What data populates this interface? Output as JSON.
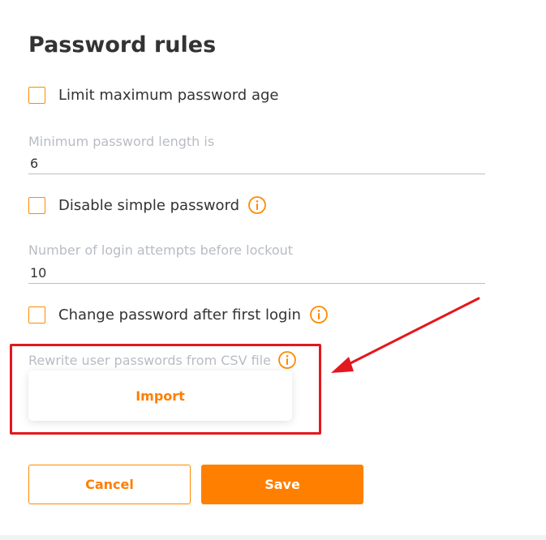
{
  "page": {
    "title": "Password rules"
  },
  "rules": {
    "limit_age_label": "Limit maximum password age",
    "min_length_label": "Minimum password length is",
    "min_length_value": "6",
    "disable_simple_label": "Disable simple password",
    "login_attempts_label": "Number of login attempts before lockout",
    "login_attempts_value": "10",
    "change_after_first_label": "Change password after first login",
    "rewrite_csv_label": "Rewrite user passwords from CSV file",
    "import_label": "Import"
  },
  "actions": {
    "cancel_label": "Cancel",
    "save_label": "Save"
  },
  "colors": {
    "accent": "#ff8000",
    "highlight_red": "#e4171e",
    "muted_label": "#b8bcc4"
  },
  "icons": {
    "info": "info-circle-icon",
    "arrow": "red-annotation-arrow"
  }
}
